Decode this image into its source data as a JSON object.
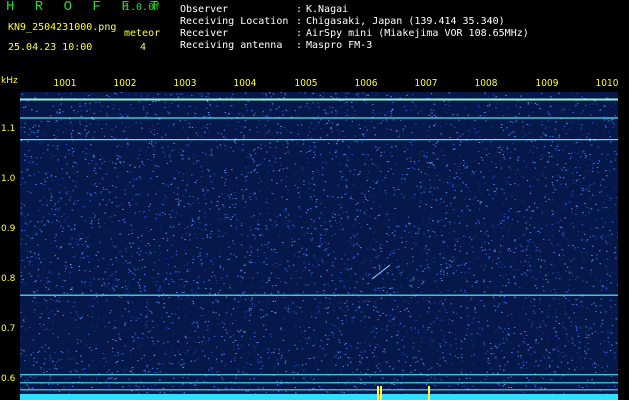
{
  "header": {
    "brand": "H R O F F T",
    "version": "1.0.0f",
    "filename": "KN9_2504231000.png",
    "datetime": "25.04.23 10:00",
    "mode_label": "meteor",
    "mode_value": "4"
  },
  "info": [
    {
      "label": "Observer",
      "value": "K.Nagai"
    },
    {
      "label": "Receiving Location",
      "value": "Chigasaki, Japan (139.414 35.340)"
    },
    {
      "label": "Receiver",
      "value": "AirSpy mini (Miakejima VOR 108.65MHz)"
    },
    {
      "label": "Receiving antenna",
      "value": "Maspro FM-3"
    }
  ],
  "axis": {
    "unit": "kHz",
    "x_ticks": [
      "1001",
      "1002",
      "1003",
      "1004",
      "1005",
      "1006",
      "1007",
      "1008",
      "1009",
      "1010"
    ],
    "y_ticks": [
      "1.1",
      "1.0",
      "0.9",
      "0.8",
      "0.7",
      "0.6"
    ]
  },
  "colors": {
    "background": "#000000",
    "plot_bg": "#06184a",
    "brand": "#22dd22",
    "label": "#ffff33",
    "carrier": "#44ffff"
  },
  "spectrogram": {
    "y_range_khz": [
      0.57,
      1.14
    ],
    "carriers_khz": [
      1.128,
      1.093,
      1.053,
      0.765,
      0.618,
      0.603,
      0.59
    ]
  }
}
